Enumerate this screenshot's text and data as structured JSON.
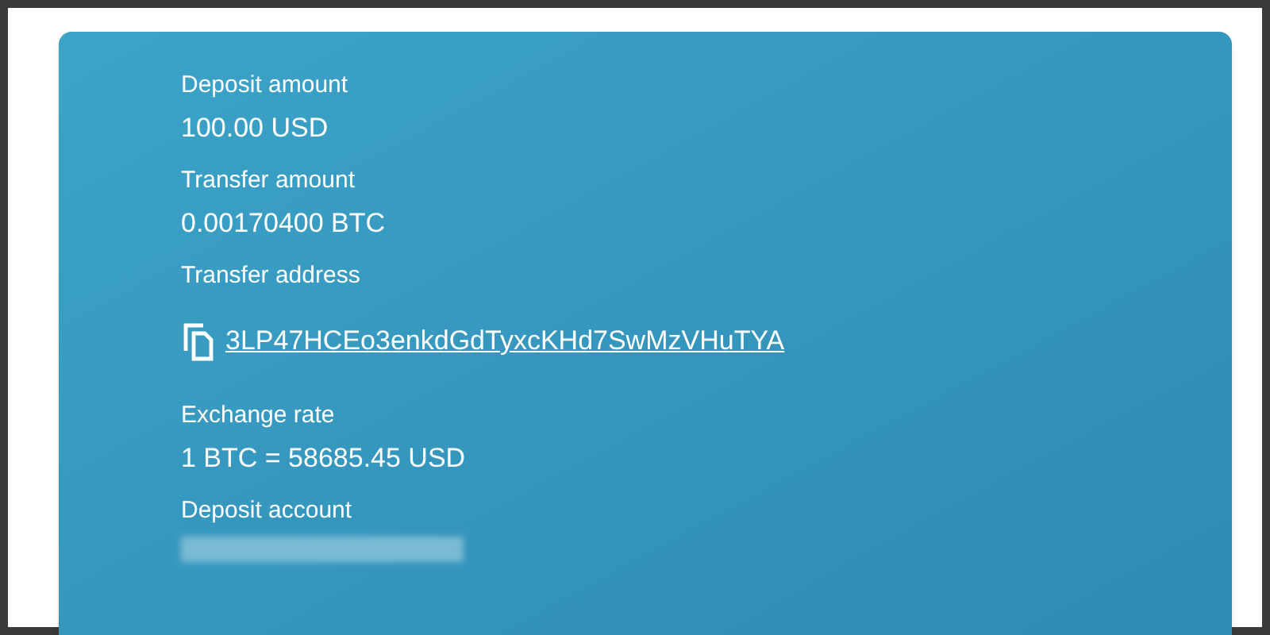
{
  "fields": [
    {
      "label": "Deposit amount",
      "kind": "text",
      "value": "100.00 USD"
    },
    {
      "label": "Transfer amount",
      "kind": "text",
      "value": "0.00170400 BTC"
    },
    {
      "label": "Transfer address",
      "kind": "copy-link",
      "value": "3LP47HCEo3enkdGdTyxcKHd7SwMzVHuTYA"
    },
    {
      "label": "Exchange rate",
      "kind": "text",
      "value": "1 BTC = 58685.45 USD"
    },
    {
      "label": "Deposit account",
      "kind": "redacted"
    }
  ]
}
